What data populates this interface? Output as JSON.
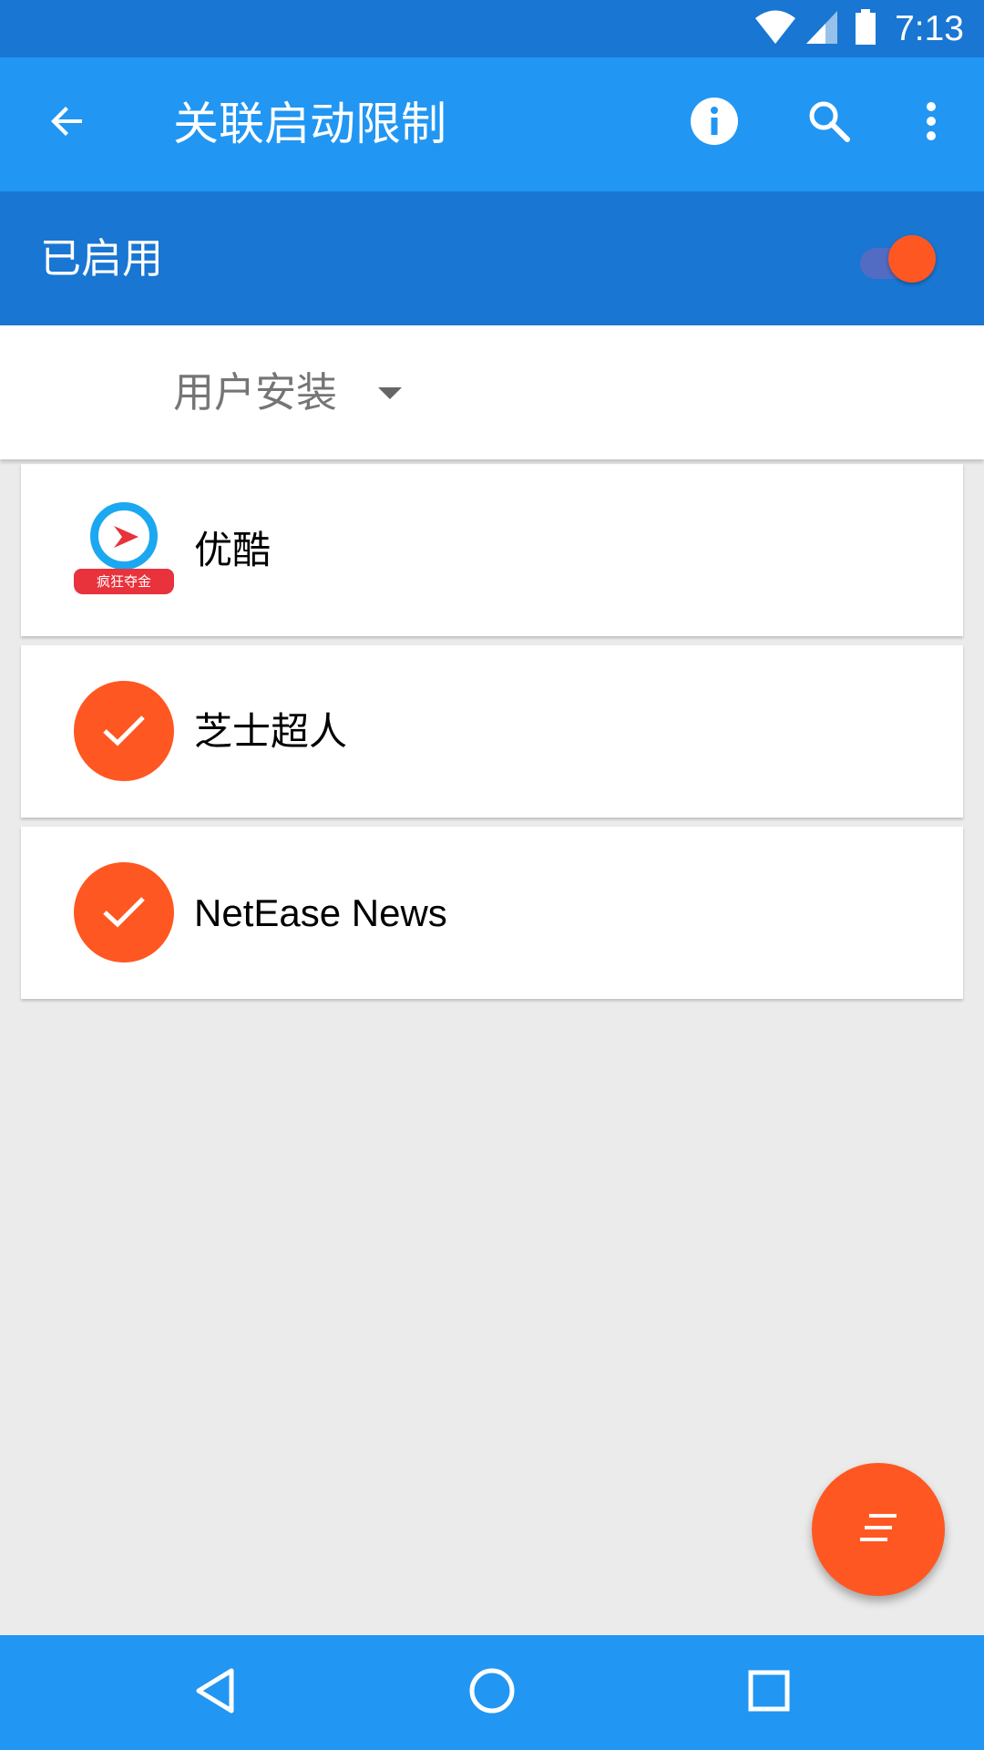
{
  "status_bar": {
    "time": "7:13",
    "icons": [
      "wifi-icon",
      "signal-icon",
      "battery-icon"
    ]
  },
  "toolbar": {
    "title": "关联启动限制",
    "back_icon": "arrow-back-icon",
    "actions": [
      "info-icon",
      "search-icon",
      "more-vert-icon"
    ]
  },
  "master_switch": {
    "label": "已启用",
    "state": "on"
  },
  "filter": {
    "selected": "用户安装"
  },
  "apps": [
    {
      "name": "优酷",
      "icon": "youku-logo",
      "badge_text": "疯狂夺金"
    },
    {
      "name": "芝士超人",
      "icon": "check-circle-icon"
    },
    {
      "name": "NetEase News",
      "icon": "check-circle-icon"
    }
  ],
  "fab": {
    "icon": "sort-icon"
  },
  "nav": [
    "nav-back-icon",
    "nav-home-icon",
    "nav-recents-icon"
  ],
  "colors": {
    "status_bar": "#1976D2",
    "toolbar": "#2196F3",
    "accent": "#FF5722",
    "background": "#EBEBEB"
  }
}
